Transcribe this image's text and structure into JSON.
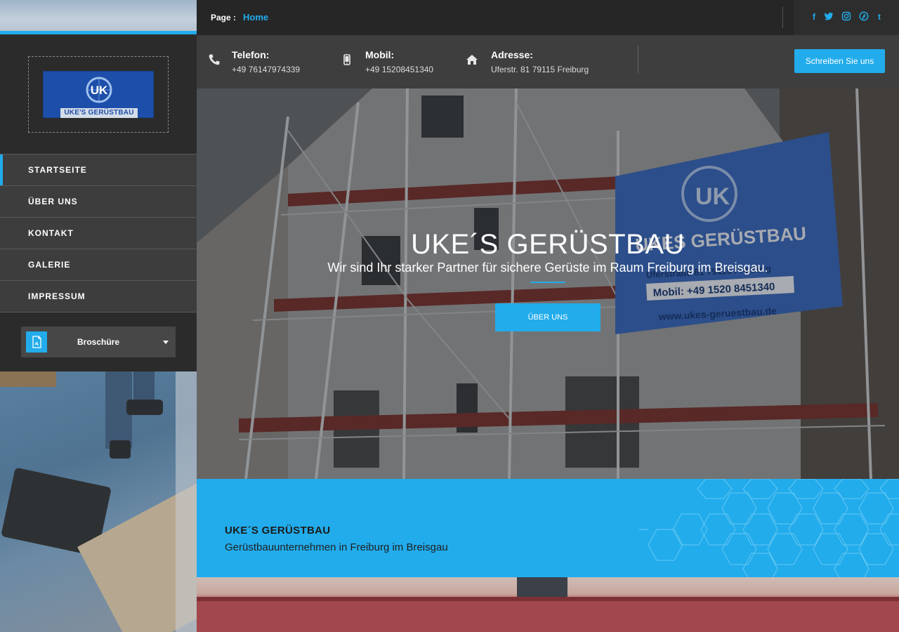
{
  "brand": {
    "logo_mark": "UK",
    "logo_text": "UKE'S GERÜSTBAU",
    "colors": {
      "accent": "#22acec",
      "sidebar_bg": "#2b2b2b",
      "nav_item_bg": "#3d3d3d",
      "topbar_bg": "#262626",
      "contact_bg": "#3e3e3e"
    }
  },
  "topbar": {
    "page_label": "Page :",
    "page_link": "Home",
    "social_icons": [
      "facebook-icon",
      "twitter-icon",
      "instagram-icon",
      "pinterest-icon",
      "tumblr-icon"
    ],
    "social_glyphs": [
      "f",
      "t",
      "◎",
      "p",
      "t"
    ]
  },
  "contact": {
    "phone": {
      "title": "Telefon:",
      "value": "+49 76147974339",
      "icon": "phone-icon"
    },
    "mobile": {
      "title": "Mobil:",
      "value": "+49 15208451340",
      "icon": "mobile-icon"
    },
    "address": {
      "title": "Adresse:",
      "value": "Uferstr. 81 79115 Freiburg",
      "icon": "home-icon"
    },
    "cta_label": "Schreiben Sie uns"
  },
  "sidebar": {
    "nav": [
      {
        "label": "STARTSEITE",
        "active": true
      },
      {
        "label": "ÜBER UNS",
        "active": false
      },
      {
        "label": "KONTAKT",
        "active": false
      },
      {
        "label": "GALERIE",
        "active": false
      },
      {
        "label": "IMPRESSUM",
        "active": false
      }
    ],
    "brochure_label": "Broschüre"
  },
  "hero": {
    "title": "UKE´S GERÜSTBAU",
    "subtitle": "Wir sind Ihr starker Partner für sichere Gerüste im Raum Freiburg im Breisgau.",
    "button_label": "ÜBER UNS",
    "banner": {
      "heading": "UKES GERÜSTBAU",
      "address": "Uferstraße 81 79115 Freiburg",
      "mobile": "Mobil: +49 1520 8451340",
      "website": "www.ukes-geruestbau.de"
    }
  },
  "band": {
    "title": "UKE´S GERÜSTBAU",
    "subtitle": "Gerüstbauunternehmen in Freiburg im Breisgau"
  }
}
